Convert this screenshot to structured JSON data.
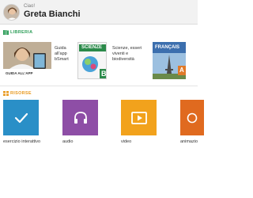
{
  "header": {
    "greeting": "Ciao!",
    "user_name": "Greta Bianchi"
  },
  "libreria": {
    "label": "LIBRERIA",
    "books": [
      {
        "title": "Guida all'app bSmart",
        "cover_text": "GUIDA ALL'APP"
      },
      {
        "title": "Scienze, esseri viventi e biodiversità",
        "cover_text": "SCIENZE",
        "cover_badge": "B"
      },
      {
        "title": "",
        "cover_text": "FRANÇAIS",
        "cover_badge": "A"
      }
    ]
  },
  "risorse": {
    "label": "RISORSE",
    "items": [
      {
        "label": "esercizio interattivo",
        "icon": "checkmark-icon",
        "color": "#2a8fc7"
      },
      {
        "label": "audio",
        "icon": "headphones-icon",
        "color": "#8e4ea6"
      },
      {
        "label": "video",
        "icon": "play-icon",
        "color": "#f2a21c"
      },
      {
        "label": "animazio",
        "icon": "animation-icon",
        "color": "#e06a1f"
      }
    ]
  },
  "colors": {
    "libreria_accent": "#2f9e5a",
    "risorse_accent": "#e89a20"
  }
}
